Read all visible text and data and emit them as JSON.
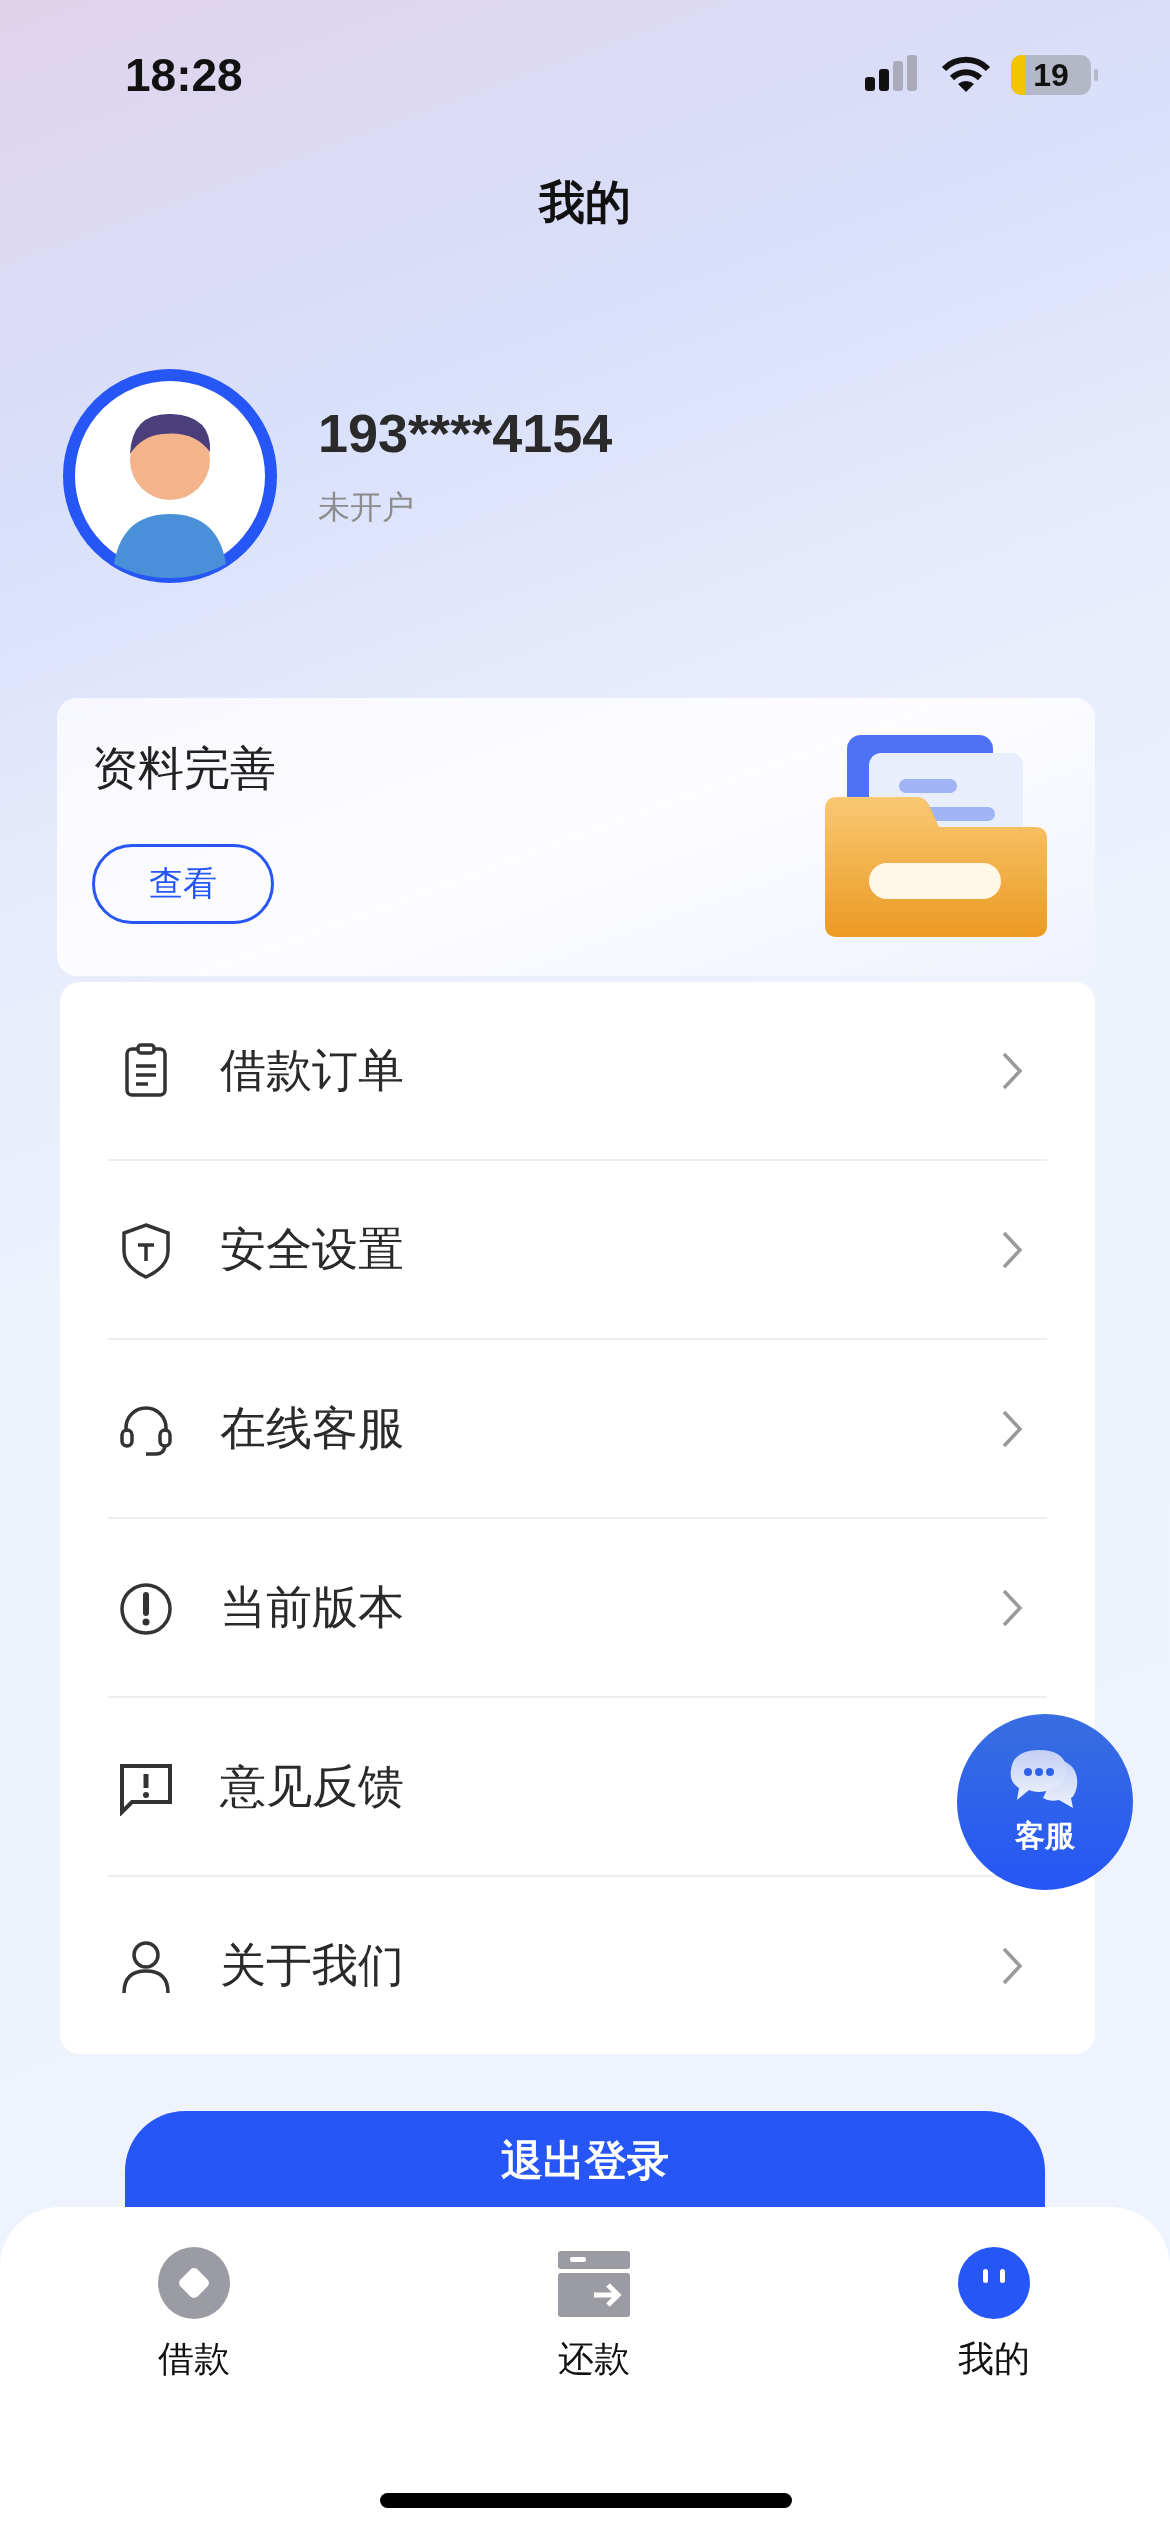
{
  "status_bar": {
    "time": "18:28",
    "battery": "19"
  },
  "header": {
    "title": "我的"
  },
  "profile": {
    "phone": "193****4154",
    "account_status": "未开户"
  },
  "info_card": {
    "title": "资料完善",
    "button": "查看"
  },
  "menu": [
    {
      "kind": "orders",
      "label": "借款订单",
      "chevron": true
    },
    {
      "kind": "security",
      "label": "安全设置",
      "chevron": true
    },
    {
      "kind": "support",
      "label": "在线客服",
      "chevron": true
    },
    {
      "kind": "version",
      "label": "当前版本",
      "chevron": true
    },
    {
      "kind": "feedback",
      "label": "意见反馈",
      "chevron": false
    },
    {
      "kind": "about",
      "label": "关于我们",
      "chevron": true
    }
  ],
  "floating_button": {
    "label": "客服"
  },
  "logout_button": "退出登录",
  "tab_bar": [
    {
      "kind": "loan",
      "label": "借款",
      "selected": false
    },
    {
      "kind": "repay",
      "label": "还款",
      "selected": false
    },
    {
      "kind": "mine",
      "label": "我的",
      "selected": true
    }
  ]
}
